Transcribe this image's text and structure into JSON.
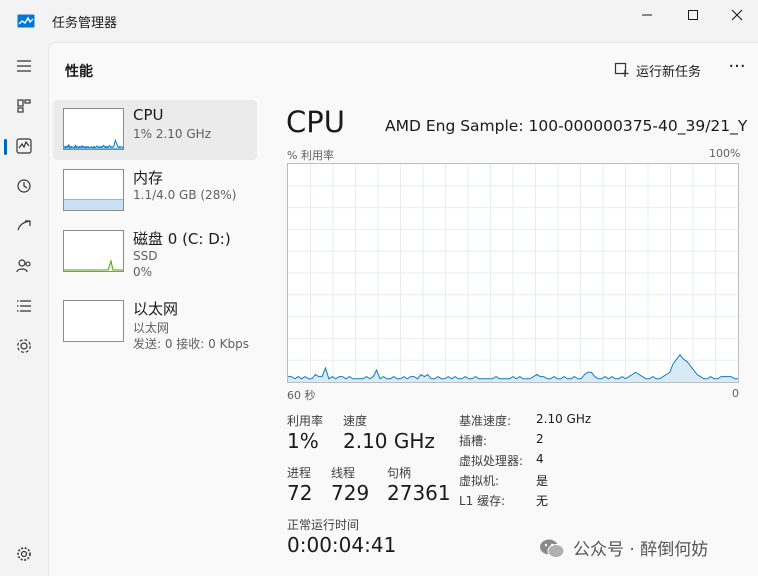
{
  "window": {
    "title": "任务管理器"
  },
  "nav": {
    "items": [
      "menu-icon",
      "processes-icon",
      "performance-icon",
      "app-history-icon",
      "startup-apps-icon",
      "users-icon",
      "details-icon",
      "services-icon"
    ],
    "settings": "gear-icon"
  },
  "header": {
    "title": "性能",
    "run_task": "运行新任务",
    "more": "···"
  },
  "sidebar": {
    "items": [
      {
        "name": "CPU",
        "lines": [
          "1% 2.10 GHz"
        ]
      },
      {
        "name": "内存",
        "lines": [
          "1.1/4.0 GB (28%)"
        ]
      },
      {
        "name": "磁盘 0 (C: D:)",
        "lines": [
          "SSD",
          "0%"
        ]
      },
      {
        "name": "以太网",
        "lines": [
          "以太网",
          "发送: 0 接收: 0 Kbps"
        ]
      }
    ],
    "memory_fill": 0.28
  },
  "main": {
    "title": "CPU",
    "model": "AMD Eng Sample: 100-000000375-40_39/21_Y",
    "util_label": "% 利用率",
    "util_max": "100%",
    "axis_left": "60 秒",
    "axis_right": "0"
  },
  "stats": {
    "utilization": {
      "label": "利用率",
      "value": "1%"
    },
    "speed": {
      "label": "速度",
      "value": "2.10 GHz"
    },
    "processes": {
      "label": "进程",
      "value": "72"
    },
    "threads": {
      "label": "线程",
      "value": "729"
    },
    "handles": {
      "label": "句柄",
      "value": "27361"
    },
    "uptime": {
      "label": "正常运行时间",
      "value": "0:00:04:41"
    }
  },
  "details": [
    {
      "label": "基准速度:",
      "value": "2.10 GHz"
    },
    {
      "label": "插槽:",
      "value": "2"
    },
    {
      "label": "虚拟处理器:",
      "value": "4"
    },
    {
      "label": "虚拟机:",
      "value": "是"
    },
    {
      "label": "L1 缓存:",
      "value": "无"
    }
  ],
  "watermark": {
    "text": "公众号 · 醉倒何妨"
  },
  "colors": {
    "cpu_line": "#117dbb",
    "cpu_fill": "#d9eaf7",
    "disk_line": "#4da60c",
    "accent": "#0067c0"
  },
  "cpu_history": [
    2,
    2,
    1,
    2,
    1,
    2,
    1,
    1,
    3,
    2,
    2,
    6,
    1,
    2,
    1,
    2,
    2,
    1,
    2,
    1,
    1,
    1,
    1,
    2,
    1,
    2,
    5,
    1,
    2,
    1,
    1,
    2,
    1,
    1,
    2,
    1,
    2,
    2,
    1,
    3,
    2,
    3,
    1,
    1,
    2,
    1,
    1,
    2,
    1,
    2,
    1,
    1,
    2,
    1,
    1,
    2,
    1,
    1,
    1,
    1,
    1,
    2,
    1,
    1,
    1,
    1,
    2,
    1,
    2,
    1,
    1,
    1,
    2,
    3,
    2,
    2,
    1,
    1,
    2,
    1,
    1,
    2,
    1,
    1,
    2,
    1,
    1,
    3,
    4,
    4,
    2,
    1,
    1,
    2,
    1,
    2,
    1,
    1,
    2,
    1,
    2,
    3,
    4,
    3,
    2,
    1,
    1,
    2,
    1,
    1,
    2,
    3,
    4,
    8,
    10,
    12,
    10,
    9,
    7,
    5,
    3,
    2,
    1,
    1,
    2,
    1,
    1,
    2,
    2,
    2,
    2,
    1,
    1
  ]
}
